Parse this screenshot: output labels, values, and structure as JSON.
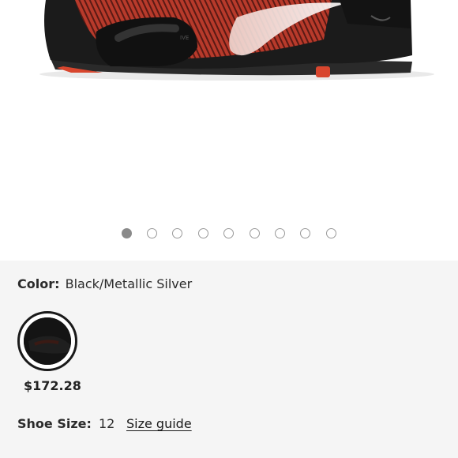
{
  "product": {
    "image_alt": "Black and red Nike cycling shoe",
    "gallery": {
      "total": 9,
      "active_index": 0
    }
  },
  "color": {
    "label": "Color:",
    "value": "Black/Metallic Silver",
    "swatch_selected": true
  },
  "price": "$172.28",
  "size": {
    "label": "Shoe Size:",
    "value": "12",
    "guide_link": "Size guide"
  },
  "colors": {
    "background": "#f5f5f5",
    "shoe_body": "#1b1b1b",
    "shoe_accent": "#c8402f",
    "active_dot": "#8a8a8a"
  }
}
